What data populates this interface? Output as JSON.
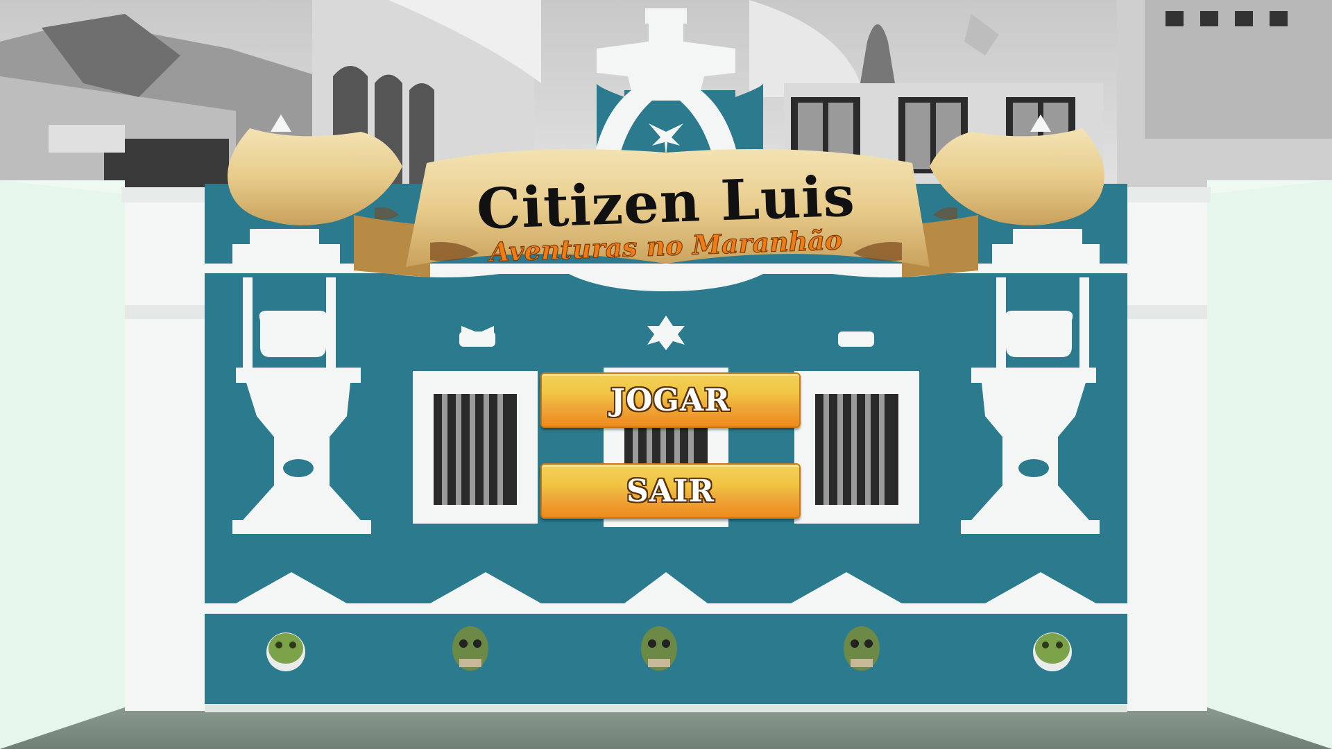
{
  "game": {
    "title": "Citizen Luis",
    "subtitle": "Aventuras no Maranhão"
  },
  "menu": {
    "play_label": "JOGAR",
    "exit_label": "SAIR"
  },
  "colors": {
    "facade_teal": "#2b7a8e",
    "trim_white": "#f4f6f5",
    "button_top": "#f3d05a",
    "button_bottom": "#ee8a1c",
    "subtitle_orange": "#f07d14"
  }
}
